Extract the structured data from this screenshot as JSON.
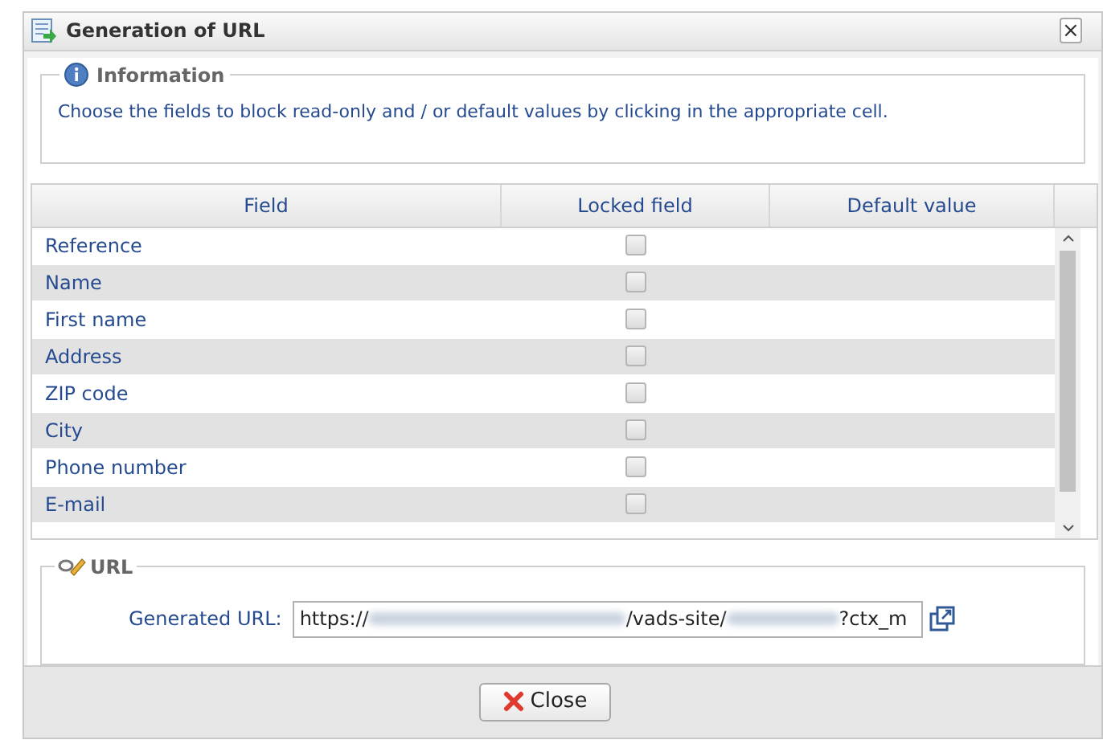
{
  "window": {
    "title": "Generation of URL",
    "close": "×"
  },
  "information": {
    "legend": "Information",
    "text": "Choose the fields to block read-only and / or default values by clicking in the appropriate cell."
  },
  "table": {
    "columns": [
      "Field",
      "Locked field",
      "Default value"
    ],
    "rows": [
      {
        "field": "Reference",
        "locked": false
      },
      {
        "field": "Name",
        "locked": false
      },
      {
        "field": "First name",
        "locked": false
      },
      {
        "field": "Address",
        "locked": false
      },
      {
        "field": "ZIP code",
        "locked": false
      },
      {
        "field": "City",
        "locked": false
      },
      {
        "field": "Phone number",
        "locked": false
      },
      {
        "field": "E-mail",
        "locked": false
      }
    ]
  },
  "url": {
    "legend": "URL",
    "label": "Generated URL:",
    "value": [
      {
        "kind": "text",
        "text": "https://"
      },
      {
        "kind": "blurred"
      },
      {
        "kind": "text",
        "text": "/vads-site/"
      },
      {
        "kind": "blurred"
      },
      {
        "kind": "text",
        "text": "?ctx_m"
      }
    ]
  },
  "buttons": [
    {
      "label": "Close"
    }
  ]
}
